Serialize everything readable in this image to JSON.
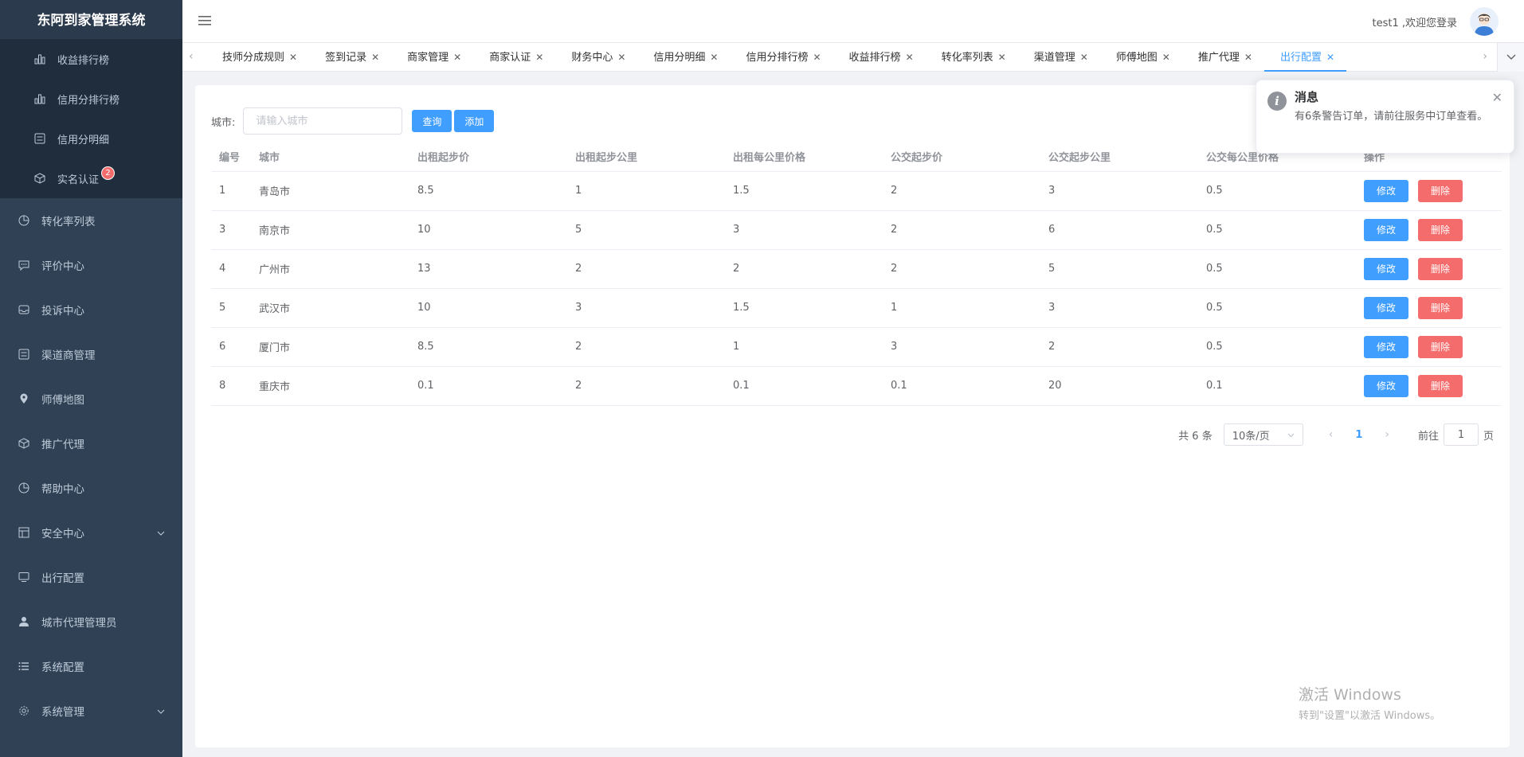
{
  "app_title": "东阿到家管理系统",
  "sidebar": {
    "sub_items": [
      {
        "label": "收益排行榜",
        "icon": "bar-chart-icon"
      },
      {
        "label": "信用分排行榜",
        "icon": "bar-chart-icon"
      },
      {
        "label": "信用分明细",
        "icon": "list-icon"
      },
      {
        "label": "实名认证",
        "icon": "box-icon",
        "badge": "2"
      }
    ],
    "items": [
      {
        "label": "转化率列表",
        "icon": "pie-chart-icon"
      },
      {
        "label": "评价中心",
        "icon": "comment-icon"
      },
      {
        "label": "投诉中心",
        "icon": "inbox-icon"
      },
      {
        "label": "渠道商管理",
        "icon": "list-icon"
      },
      {
        "label": "师傅地图",
        "icon": "location-icon"
      },
      {
        "label": "推广代理",
        "icon": "box-icon"
      },
      {
        "label": "帮助中心",
        "icon": "pie-chart-icon"
      },
      {
        "label": "安全中心",
        "icon": "shield-icon",
        "has_arrow": true
      },
      {
        "label": "出行配置",
        "icon": "monitor-icon"
      },
      {
        "label": "城市代理管理员",
        "icon": "user-icon"
      },
      {
        "label": "系统配置",
        "icon": "menu-list-icon"
      },
      {
        "label": "系统管理",
        "icon": "gear-icon",
        "has_arrow": true
      }
    ]
  },
  "header": {
    "welcome": "test1 ,欢迎您登录"
  },
  "tabs": [
    {
      "label": "技师分成规则"
    },
    {
      "label": "签到记录"
    },
    {
      "label": "商家管理"
    },
    {
      "label": "商家认证"
    },
    {
      "label": "财务中心"
    },
    {
      "label": "信用分明细"
    },
    {
      "label": "信用分排行榜"
    },
    {
      "label": "收益排行榜"
    },
    {
      "label": "转化率列表"
    },
    {
      "label": "渠道管理"
    },
    {
      "label": "师傅地图"
    },
    {
      "label": "推广代理"
    },
    {
      "label": "出行配置",
      "active": true
    }
  ],
  "filter": {
    "label": "城市:",
    "placeholder": "请输入城市",
    "query_label": "查询",
    "add_label": "添加"
  },
  "table": {
    "columns": [
      "编号",
      "城市",
      "出租起步价",
      "出租起步公里",
      "出租每公里价格",
      "公交起步价",
      "公交起步公里",
      "公交每公里价格",
      "操作"
    ],
    "rows": [
      [
        "1",
        "青岛市",
        "8.5",
        "1",
        "1.5",
        "2",
        "3",
        "0.5"
      ],
      [
        "3",
        "南京市",
        "10",
        "5",
        "3",
        "2",
        "6",
        "0.5"
      ],
      [
        "4",
        "广州市",
        "13",
        "2",
        "2",
        "2",
        "5",
        "0.5"
      ],
      [
        "5",
        "武汉市",
        "10",
        "3",
        "1.5",
        "1",
        "3",
        "0.5"
      ],
      [
        "6",
        "厦门市",
        "8.5",
        "2",
        "1",
        "3",
        "2",
        "0.5"
      ],
      [
        "8",
        "重庆市",
        "0.1",
        "2",
        "0.1",
        "0.1",
        "20",
        "0.1"
      ]
    ],
    "edit_label": "修改",
    "delete_label": "删除"
  },
  "pagination": {
    "total": "共 6 条",
    "page_size": "10条/页",
    "current": "1",
    "goto_prefix": "前往",
    "goto_value": "1",
    "goto_suffix": "页"
  },
  "notification": {
    "title": "消息",
    "message": "有6条警告订单，请前往服务中订单查看。"
  },
  "watermark": {
    "title": "激活 Windows",
    "subtitle": "转到\"设置\"以激活 Windows。"
  }
}
